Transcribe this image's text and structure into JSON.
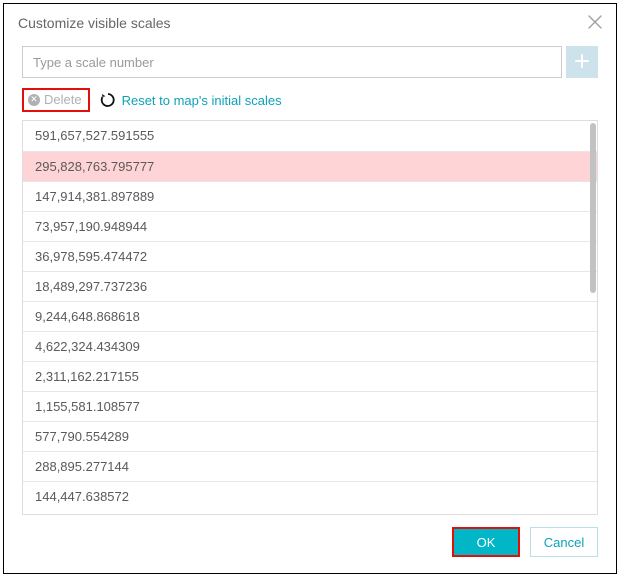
{
  "dialog": {
    "title": "Customize visible scales",
    "input_placeholder": "Type a scale number",
    "delete_label": "Delete",
    "reset_label": "Reset to map's initial scales",
    "ok_label": "OK",
    "cancel_label": "Cancel"
  },
  "scales": [
    {
      "value": "591,657,527.591555",
      "selected": false
    },
    {
      "value": "295,828,763.795777",
      "selected": true
    },
    {
      "value": "147,914,381.897889",
      "selected": false
    },
    {
      "value": "73,957,190.948944",
      "selected": false
    },
    {
      "value": "36,978,595.474472",
      "selected": false
    },
    {
      "value": "18,489,297.737236",
      "selected": false
    },
    {
      "value": "9,244,648.868618",
      "selected": false
    },
    {
      "value": "4,622,324.434309",
      "selected": false
    },
    {
      "value": "2,311,162.217155",
      "selected": false
    },
    {
      "value": "1,155,581.108577",
      "selected": false
    },
    {
      "value": "577,790.554289",
      "selected": false
    },
    {
      "value": "288,895.277144",
      "selected": false
    },
    {
      "value": "144,447.638572",
      "selected": false
    }
  ],
  "icons": {
    "close": "close-icon",
    "plus": "plus-icon",
    "delete": "x-circle-icon",
    "reset": "refresh-icon"
  },
  "colors": {
    "accent": "#00b6c7",
    "link": "#0ca3b8",
    "highlight_row": "#ffd4d6",
    "annotation_border": "#e40f0b"
  }
}
